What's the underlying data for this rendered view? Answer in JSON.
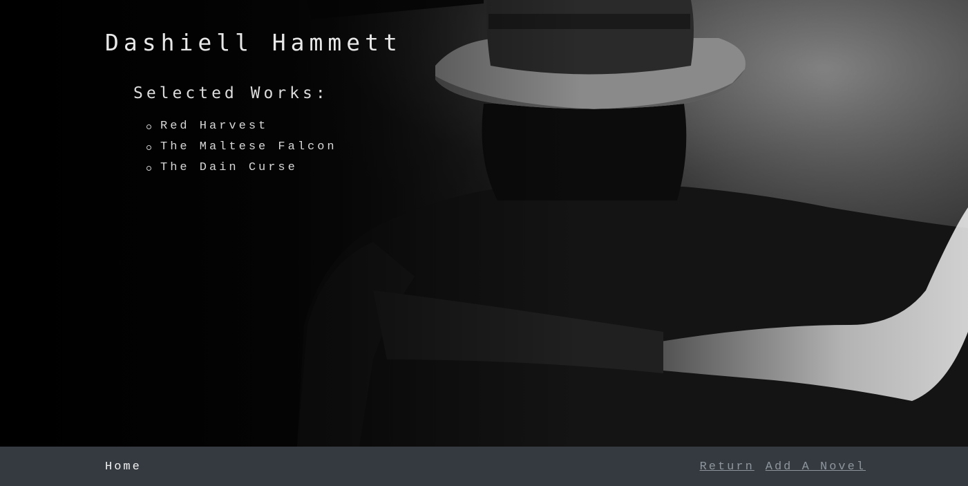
{
  "author": {
    "name": "Dashiell Hammett"
  },
  "works": {
    "heading": "Selected Works:",
    "items": [
      "Red Harvest",
      "The Maltese Falcon",
      "The Dain Curse"
    ]
  },
  "footer": {
    "home_label": "Home",
    "return_label": "Return",
    "add_novel_label": "Add A Novel"
  },
  "colors": {
    "footer_bg": "#343a40",
    "link_color": "#8e959c"
  },
  "background_image": "man-in-fedora-photo"
}
